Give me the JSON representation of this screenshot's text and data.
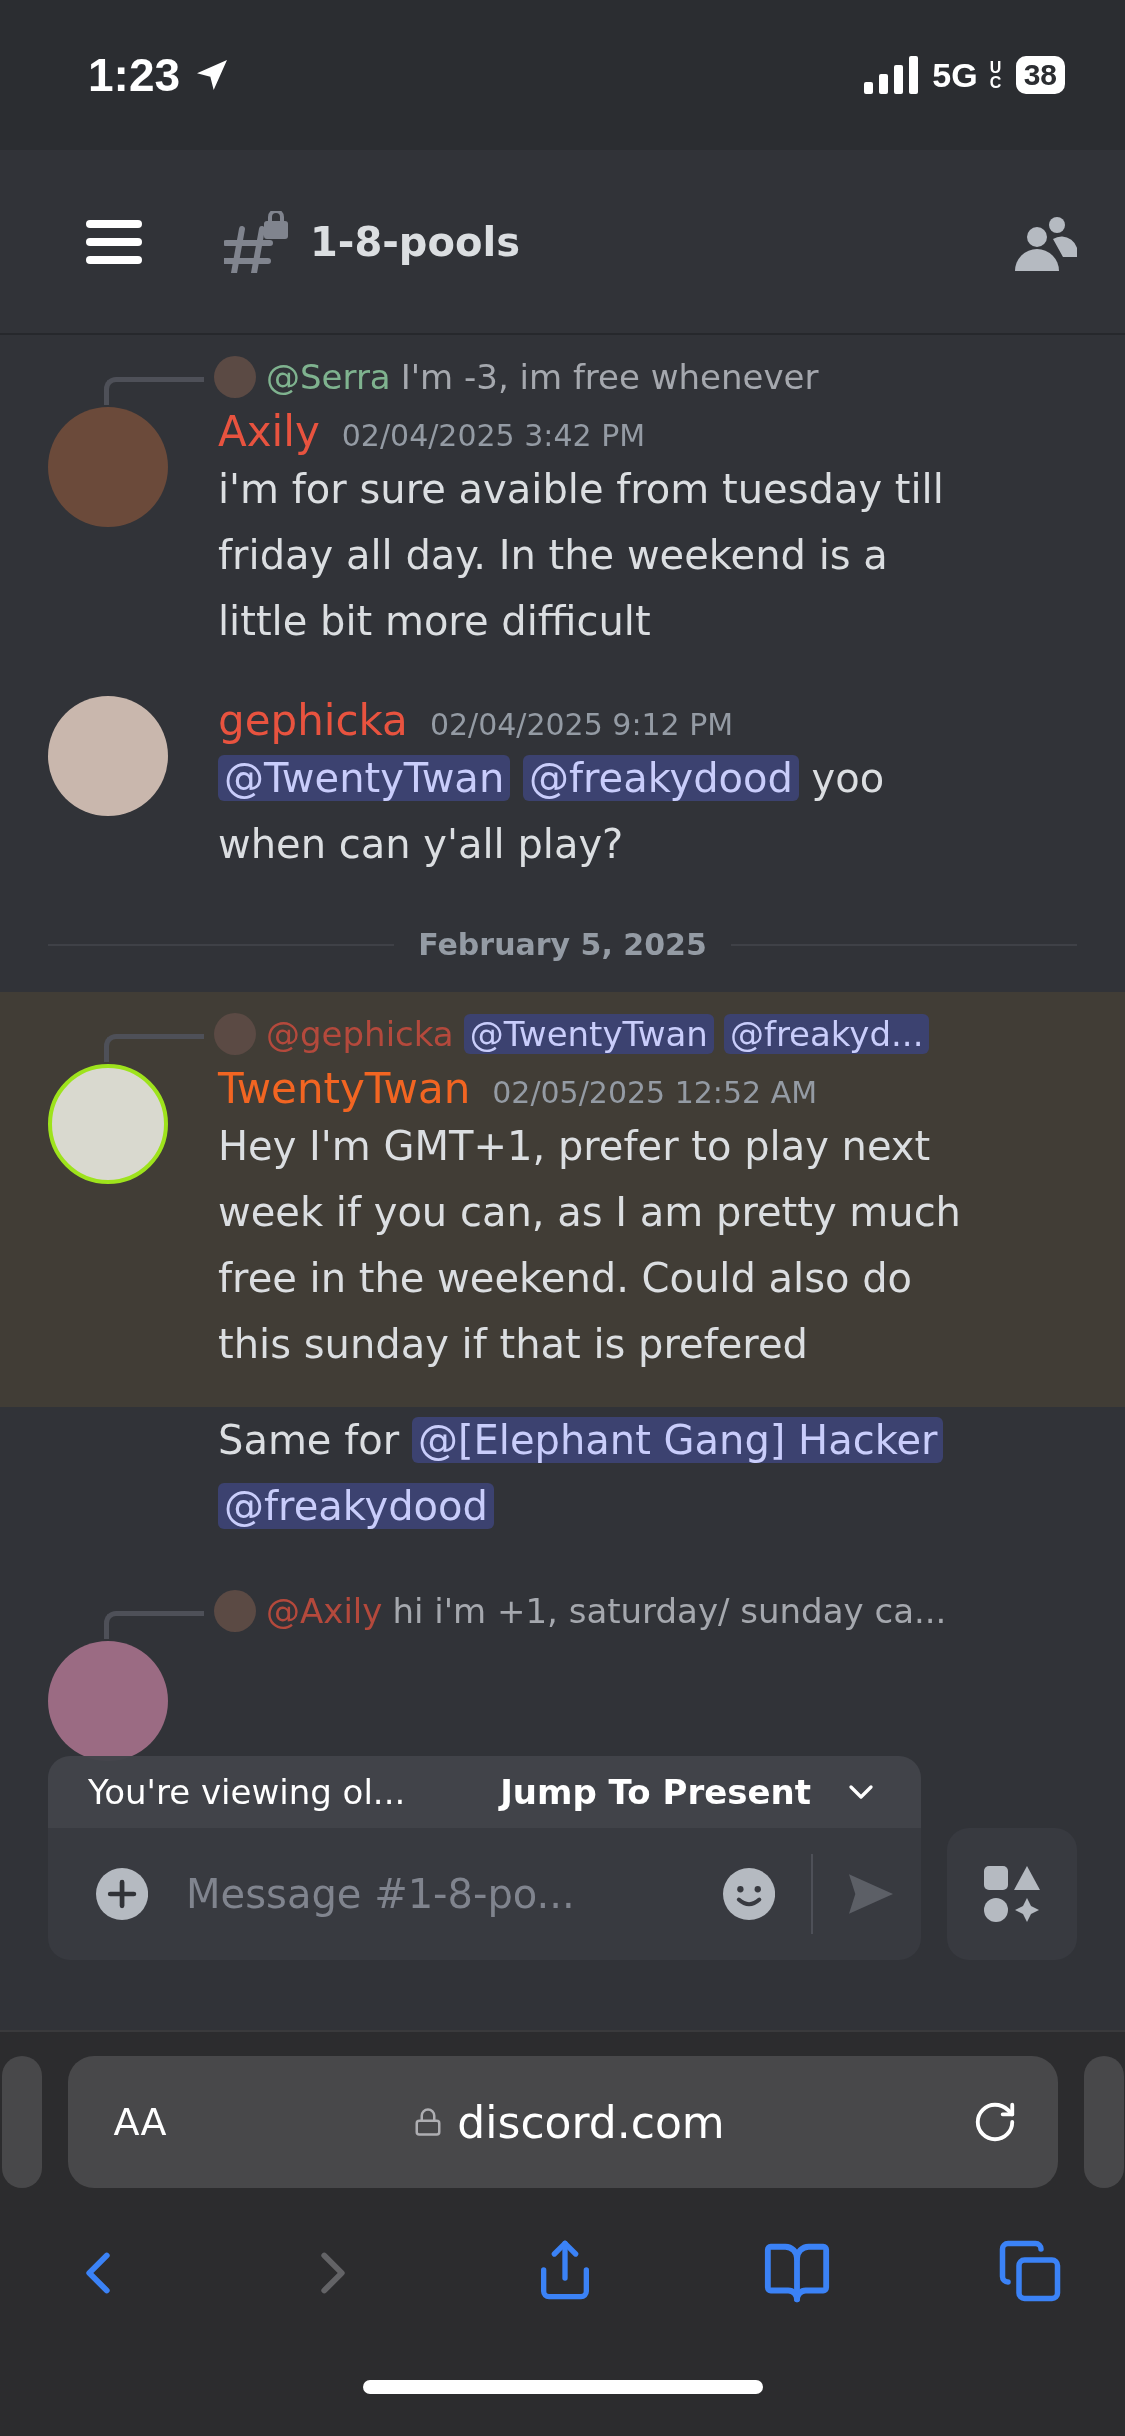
{
  "status_bar": {
    "time": "1:23",
    "network": "5G",
    "network_suffix": "UC",
    "battery": "38"
  },
  "channel_header": {
    "name": "1-8-pools"
  },
  "messages": [
    {
      "kind": "message",
      "highlighted": false,
      "reply": {
        "author": "@Serra",
        "color": "#7fb38f",
        "segments": [
          {
            "text": "I'm -3, im free whenever"
          }
        ]
      },
      "author": "Axily",
      "color": "#e8533f",
      "timestamp": "02/04/2025 3:42 PM",
      "body": [
        {
          "text": "i'm for sure avaible from tuesday till friday all day. In the weekend is a little bit more difficult"
        }
      ]
    },
    {
      "kind": "message",
      "highlighted": false,
      "author": "gephicka",
      "color": "#e8533f",
      "timestamp": "02/04/2025 9:12 PM",
      "body": [
        {
          "mention": "@TwentyTwan"
        },
        {
          "mention": "@freakydood"
        },
        {
          "text": "yoo when can y'all play?"
        }
      ]
    },
    {
      "kind": "date_divider",
      "text": "February 5, 2025"
    },
    {
      "kind": "message",
      "highlighted": true,
      "reply": {
        "author": "@gephicka",
        "color": "#b4493c",
        "segments": [
          {
            "mention": "@TwentyTwan"
          },
          {
            "mention": "@freakyd..."
          }
        ]
      },
      "author": "TwentyTwan",
      "color": "#f26522",
      "timestamp": "02/05/2025 12:52 AM",
      "body": [
        {
          "text": "Hey I'm GMT+1, prefer to play next week if you can, as I am pretty much free in the weekend. Could also do this sunday if that is prefered"
        }
      ]
    },
    {
      "kind": "continuation",
      "highlighted": false,
      "body": [
        {
          "text": "Same for"
        },
        {
          "mention": "@[Elephant Gang] Hacker"
        },
        {
          "mention": "@freakydood"
        }
      ]
    },
    {
      "kind": "reply_only",
      "reply": {
        "author": "@Axily",
        "color": "#b4493c",
        "segments": [
          {
            "text": "hi i'm +1, saturday/ sunday ca..."
          }
        ]
      }
    }
  ],
  "jump_banner": {
    "text": "You're viewing ol...",
    "action": "Jump To Present"
  },
  "composer": {
    "placeholder": "Message #1-8-po..."
  },
  "browser": {
    "text_size": "AA",
    "url": "discord.com"
  }
}
